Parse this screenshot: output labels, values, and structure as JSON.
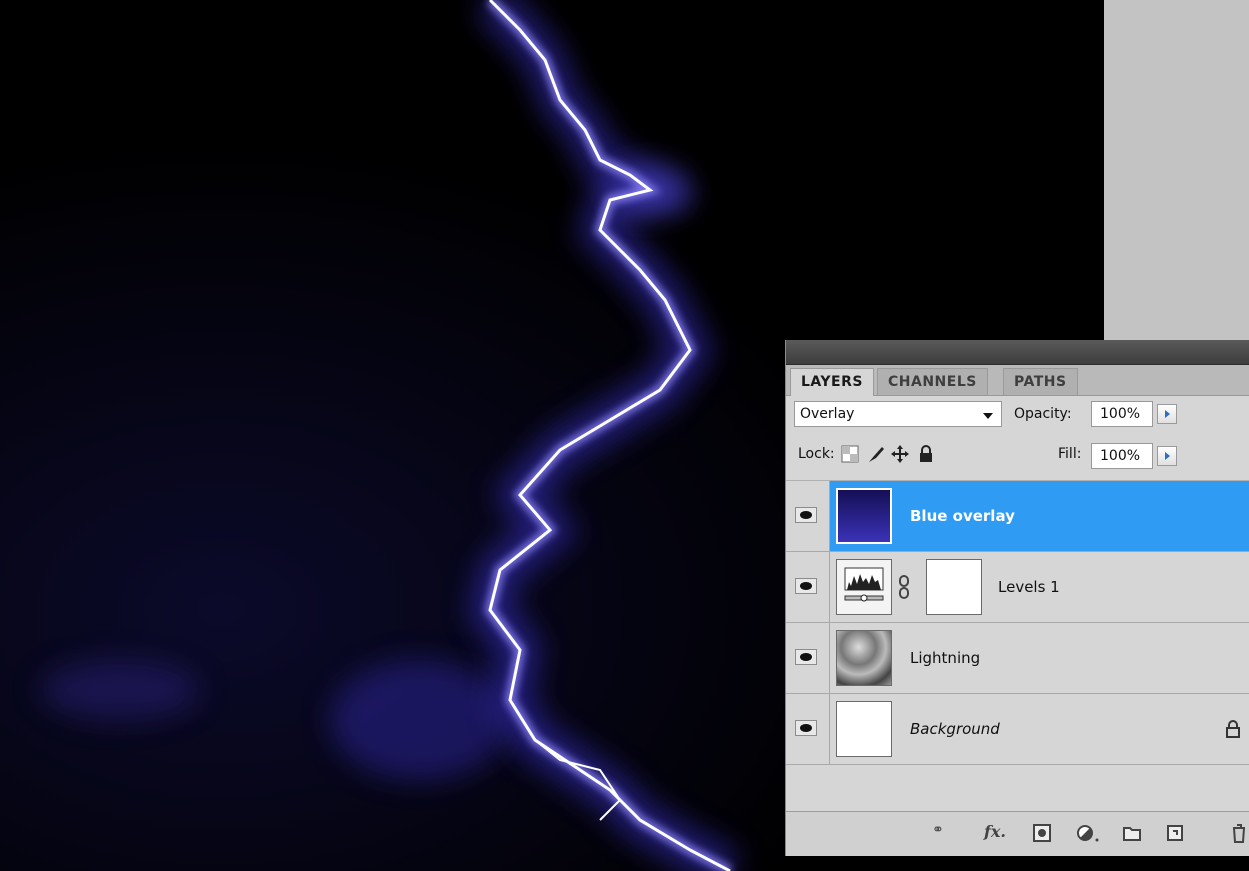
{
  "panel": {
    "tabs": [
      {
        "label": "LAYERS"
      },
      {
        "label": "CHANNELS"
      },
      {
        "label": "PATHS"
      }
    ],
    "blend_mode": "Overlay",
    "opacity_label": "Opacity:",
    "opacity_value": "100%",
    "lock_label": "Lock:",
    "fill_label": "Fill:",
    "fill_value": "100%",
    "layers": [
      {
        "name": "Blue overlay",
        "selected": true
      },
      {
        "name": "Levels 1",
        "selected": false
      },
      {
        "name": "Lightning",
        "selected": false
      },
      {
        "name": "Background",
        "selected": false
      }
    ],
    "footer_icons": [
      "link-layers-icon",
      "fx-icon",
      "add-mask-icon",
      "adjustment-layer-icon",
      "new-group-icon",
      "new-layer-icon",
      "delete-layer-icon"
    ],
    "fx_text": "fx"
  },
  "colors": {
    "selected_row": "#2f9bf3",
    "lightning_glow": "#4b44d8",
    "panel_bg": "#d6d6d6"
  }
}
